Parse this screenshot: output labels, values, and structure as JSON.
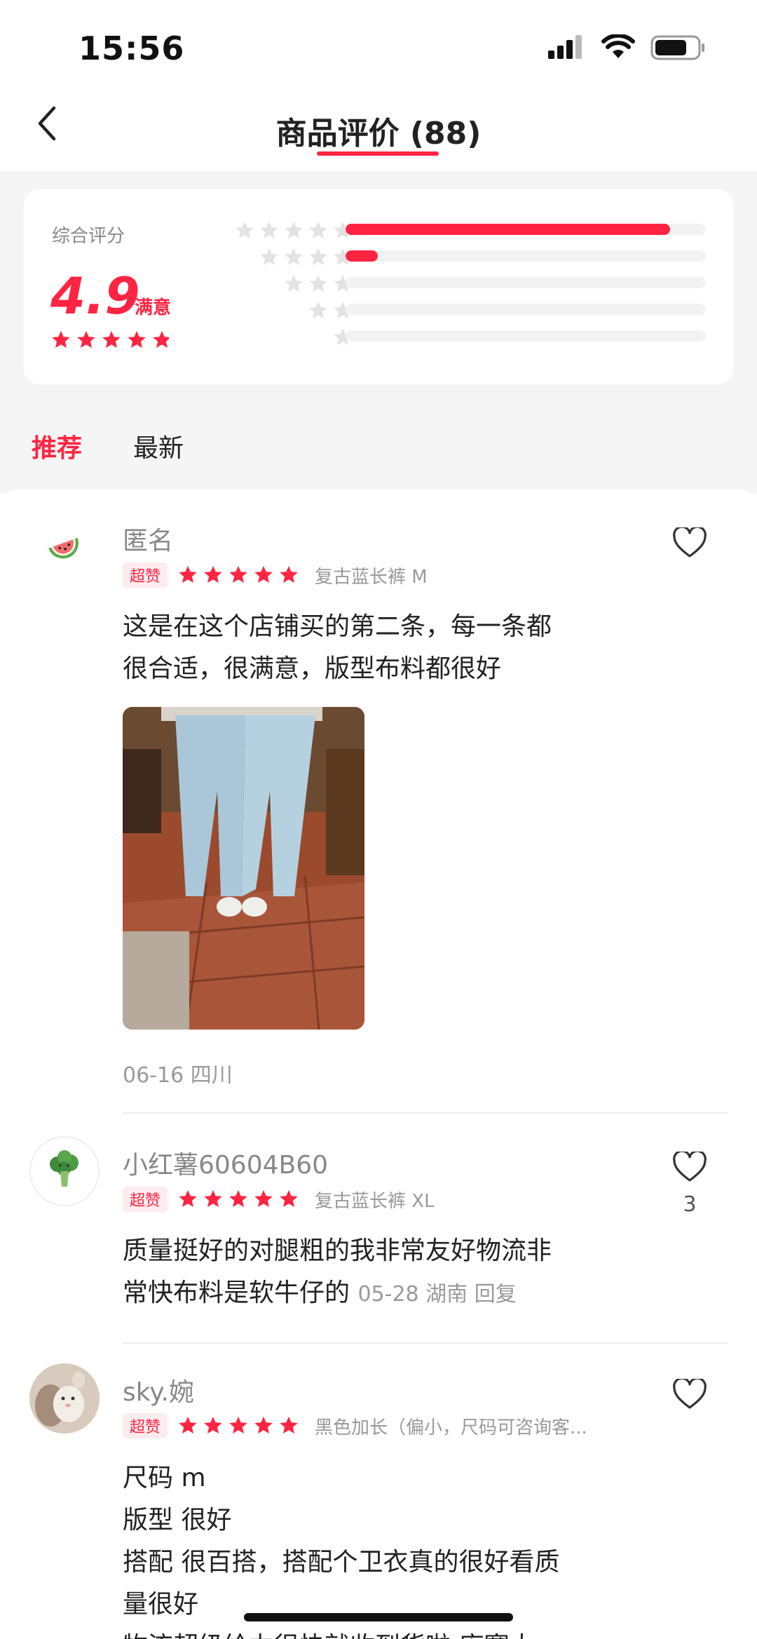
{
  "status_bar": {
    "time": "15:56"
  },
  "header": {
    "title": "商品评价 (88)"
  },
  "summary": {
    "label": "综合评分",
    "score": "4.9",
    "satisfaction": "满意",
    "score_stars": 4.9,
    "distribution": [
      {
        "stars": 5,
        "fill": 0.9
      },
      {
        "stars": 4,
        "fill": 0.09
      },
      {
        "stars": 3,
        "fill": 0.0
      },
      {
        "stars": 2,
        "fill": 0.0
      },
      {
        "stars": 1,
        "fill": 0.0
      }
    ]
  },
  "tabs": [
    {
      "label": "推荐",
      "active": true
    },
    {
      "label": "最新",
      "active": false
    }
  ],
  "reviews": [
    {
      "name": "匿名",
      "badge": "超赞",
      "rating": 5,
      "variant": "复古蓝长裤  M",
      "text_lines": [
        "这是在这个店铺买的第二条，每一条都",
        "很合适，很满意，版型布料都很好"
      ],
      "date_location": "06-16 四川",
      "avatar_icon": "watermelon-icon"
    },
    {
      "name": "小红薯60604B60",
      "badge": "超赞",
      "rating": 5,
      "variant": "复古蓝长裤  XL",
      "text_lines": [
        "质量挺好的对腿粗的我非常友好物流非",
        "常快布料是软牛仔的"
      ],
      "inline_meta": "05-28 湖南 回复",
      "like_count": "3",
      "avatar_icon": "broccoli-icon"
    },
    {
      "name": "sky.婉",
      "badge": "超赞",
      "rating": 5,
      "variant": "黑色加长（偏小，尺码可咨询客...",
      "text_lines": [
        "尺码 m",
        "版型 很好",
        "搭配 很百搭，搭配个卫衣真的很好看质",
        "量很好",
        "物流超级给力很快就收到货啦 库赛大"
      ],
      "avatar_icon": "user-photo-avatar"
    }
  ],
  "colors": {
    "accent": "#ff2442",
    "grey_bg": "#f5f5f5",
    "muted_text": "#999999"
  }
}
